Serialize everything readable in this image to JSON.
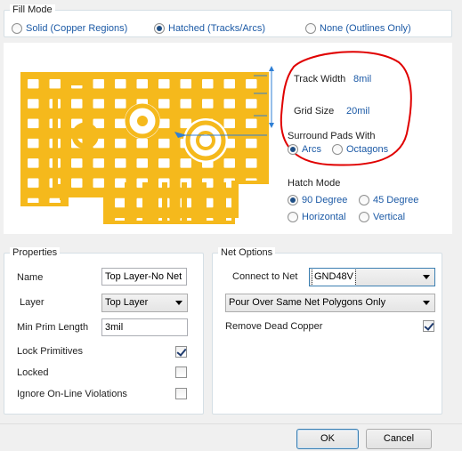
{
  "fill_mode": {
    "title": "Fill Mode",
    "options": [
      {
        "label": "Solid (Copper Regions)",
        "checked": false
      },
      {
        "label": "Hatched (Tracks/Arcs)",
        "checked": true
      },
      {
        "label": "None (Outlines Only)",
        "checked": false
      }
    ]
  },
  "hatch_settings": {
    "track_width_label": "Track Width",
    "track_width_value": "8mil",
    "grid_size_label": "Grid Size",
    "grid_size_value": "20mil",
    "surround_label": "Surround Pads With",
    "surround_options": [
      {
        "label": "Arcs",
        "checked": true
      },
      {
        "label": "Octagons",
        "checked": false
      }
    ],
    "hatch_mode_label": "Hatch Mode",
    "hatch_mode_options": [
      {
        "label": "90 Degree",
        "checked": true
      },
      {
        "label": "45 Degree",
        "checked": false
      },
      {
        "label": "Horizontal",
        "checked": false
      },
      {
        "label": "Vertical",
        "checked": false
      }
    ]
  },
  "properties": {
    "title": "Properties",
    "name_label": "Name",
    "name_value": "Top Layer-No Net",
    "layer_label": "Layer",
    "layer_value": "Top Layer",
    "min_prim_label": "Min Prim Length",
    "min_prim_value": "3mil",
    "lock_primitives_label": "Lock Primitives",
    "lock_primitives_checked": true,
    "locked_label": "Locked",
    "locked_checked": false,
    "ignore_online_label": "Ignore On-Line Violations",
    "ignore_online_checked": false
  },
  "net_options": {
    "title": "Net Options",
    "connect_label": "Connect to Net",
    "connect_value": "GND48V",
    "pour_value": "Pour Over Same Net Polygons Only",
    "remove_dead_label": "Remove Dead Copper",
    "remove_dead_checked": true
  },
  "buttons": {
    "ok": "OK",
    "cancel": "Cancel"
  },
  "colors": {
    "copper": "#f5b91c",
    "annotation": "#e00000",
    "option_text": "#1c5aa6"
  }
}
